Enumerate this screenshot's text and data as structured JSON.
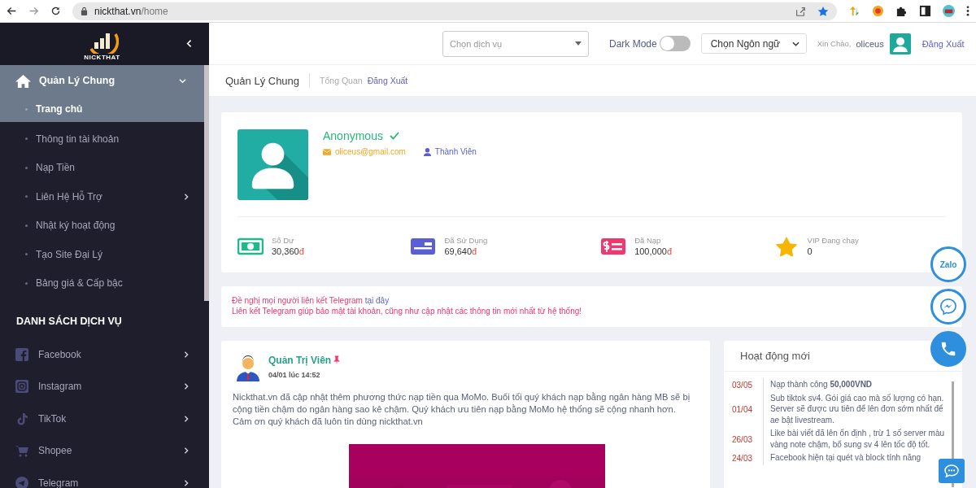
{
  "browser": {
    "url_host": "nickthat.vn",
    "url_path": "/home"
  },
  "sidebar": {
    "logo_text": "NICKTHAT",
    "group": {
      "label": "Quản Lý Chung",
      "expanded": true,
      "items": [
        {
          "label": "Trang chủ",
          "selected": true,
          "kind": "link"
        },
        {
          "label": "Thông tin tài khoản",
          "selected": false,
          "kind": "link"
        },
        {
          "label": "Nạp Tiền",
          "selected": false,
          "kind": "link"
        },
        {
          "label": "Liên Hệ Hỗ Trợ",
          "selected": false,
          "kind": "submenu"
        },
        {
          "label": "Nhật ký hoạt động",
          "selected": false,
          "kind": "link"
        },
        {
          "label": "Tạo Site Đại Lý",
          "selected": false,
          "kind": "link"
        },
        {
          "label": "Bảng giá & Cấp bậc",
          "selected": false,
          "kind": "link"
        }
      ]
    },
    "section_title": "DANH SÁCH DỊCH VỤ",
    "services": [
      {
        "label": "Facebook",
        "kind": "facebook"
      },
      {
        "label": "Instagram",
        "kind": "instagram"
      },
      {
        "label": "TikTok",
        "kind": "tiktok"
      },
      {
        "label": "Shopee",
        "kind": "shopee"
      },
      {
        "label": "Telegram",
        "kind": "telegram"
      }
    ]
  },
  "header": {
    "service_select": {
      "placeholder": "Chọn dịch vụ"
    },
    "dark_mode": {
      "label": "Dark Mode",
      "on": false
    },
    "language_select": {
      "value": "Chọn Ngôn ngữ"
    },
    "greeting": "Xin Chào,",
    "username": "oliceus",
    "logout": "Đăng Xuất"
  },
  "breadcrumb": {
    "title": "Quản Lý Chung",
    "links": [
      "Tổng Quan",
      "Đăng Xuất"
    ]
  },
  "profile": {
    "name": "Anonymous",
    "verified": true,
    "email": "oliceus@gmail.com",
    "role": "Thành Viên",
    "stats": [
      {
        "kind": "cash",
        "label": "Số Dư",
        "value": "30,360",
        "currency": "đ"
      },
      {
        "kind": "card",
        "label": "Đã Sử Dụng",
        "value": "69,640",
        "currency": "đ"
      },
      {
        "kind": "dollar",
        "label": "Đã Nạp",
        "value": "100,000",
        "currency": "đ"
      },
      {
        "kind": "star",
        "label": "VIP Đang chạy",
        "value": "0"
      }
    ]
  },
  "notice": {
    "line1": "Đề nghị mọi người liên kết Telegram",
    "link": "tại đây",
    "line2": "Liên kết Telegram giúp bảo mật tài khoản, cũng như cập nhật các thông tin mới nhất từ hệ thống!"
  },
  "post": {
    "author": "Quản Trị Viên",
    "pinned": true,
    "time": "04/01 lúc 14:52",
    "body": "Nickthat.vn đã cập nhật thêm phương thức nạp tiền qua MoMo. Buổi tối quý khách nạp bằng ngân hàng MB sẽ bị cộng tiền chậm do ngân hàng sao kê chậm. Quý khách ưu tiên nạp bằng MoMo hệ thống sẽ cộng nhanh hơn. Cảm ơn quý khách đã luôn tin dùng nickthat.vn"
  },
  "activity": {
    "title": "Hoạt động mới",
    "items": [
      {
        "date": "03/05",
        "text": "Nạp thành công **50,000VND**"
      },
      {
        "date": "01/04",
        "text": "Sub tiktok sv4. Gói giá cao mà số lượng có hạn. Server sẽ được ưu tiên để lên đơn sớm nhất để ae bật livestream."
      },
      {
        "date": "26/03",
        "text": "Like bài viết đã lên ổn định , trừ 1 số server màu vàng note chậm, bổ sung sv 4 lên tốc độ tốt."
      },
      {
        "date": "24/03",
        "text": "Facebook hiện tại quét và block tính năng"
      }
    ]
  },
  "floating": {
    "zalo_label": "Zalo"
  }
}
